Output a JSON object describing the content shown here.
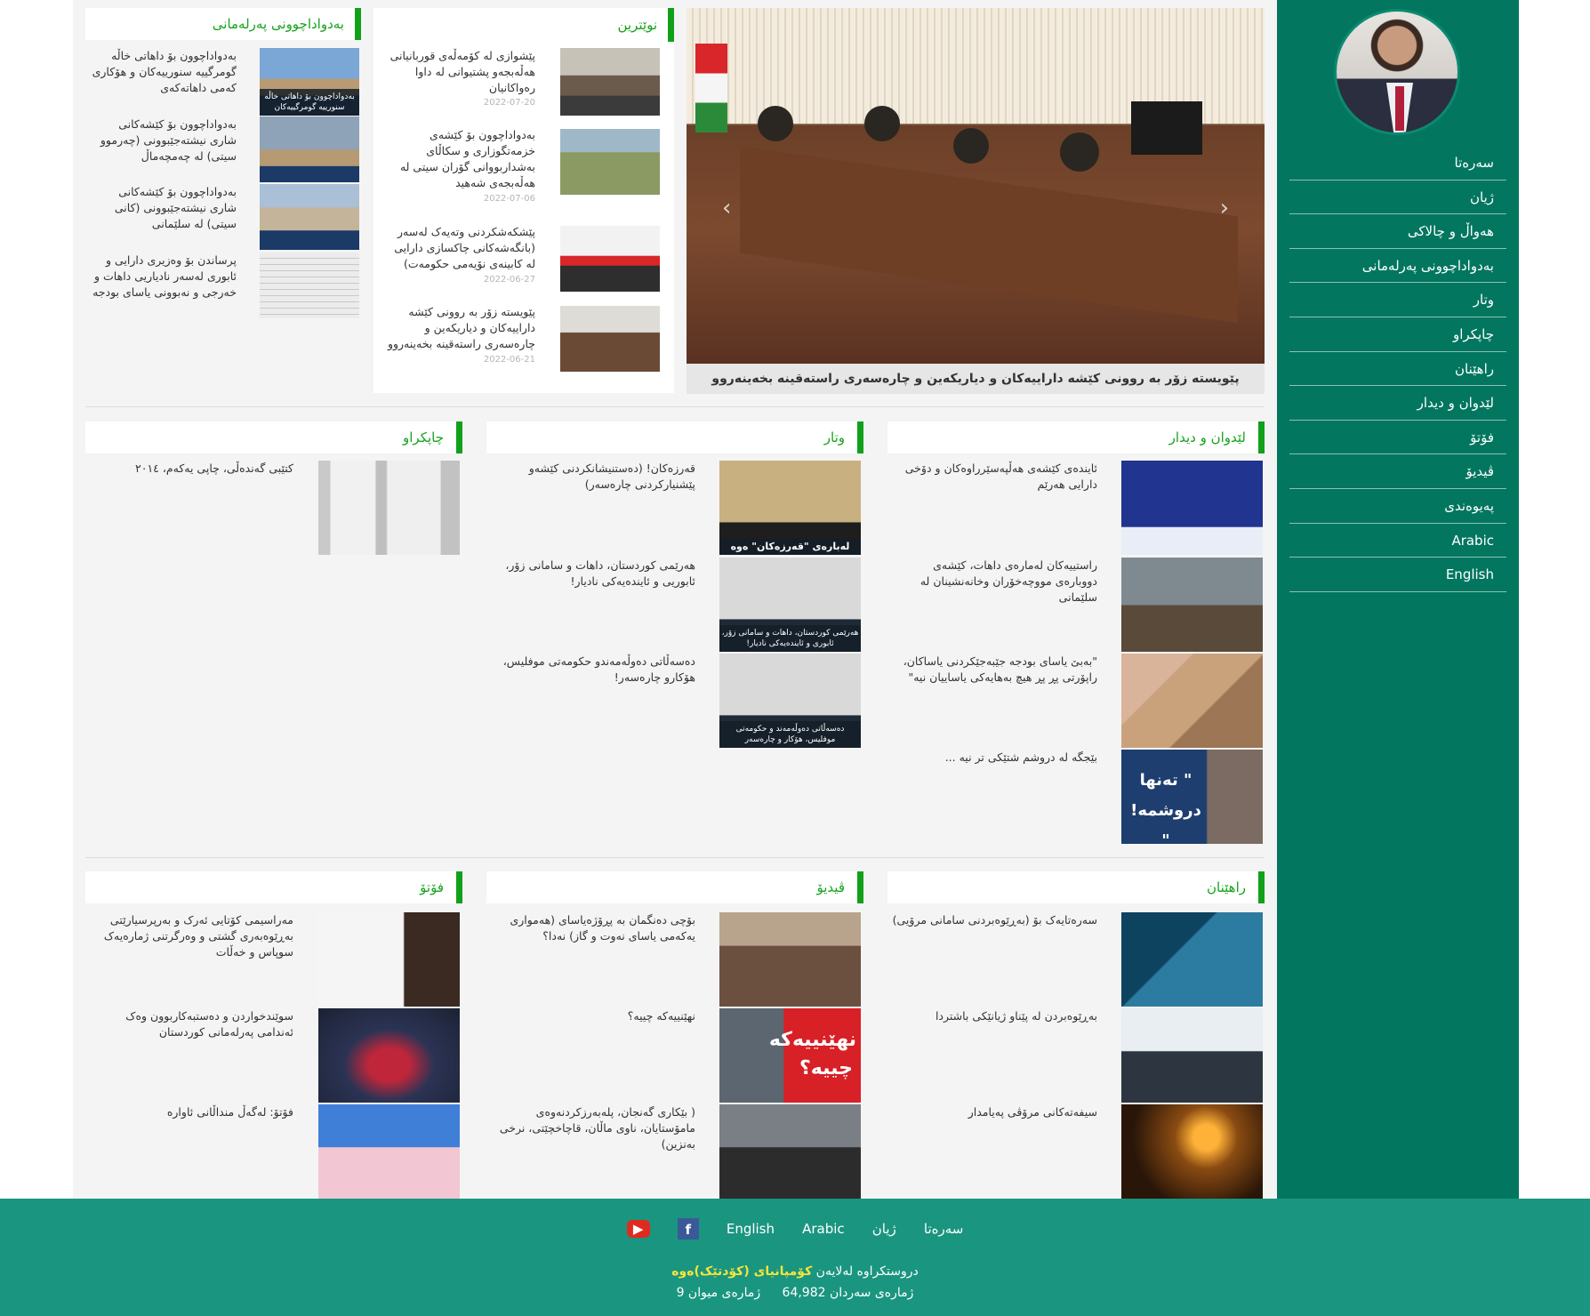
{
  "colors": {
    "sidebar": "#02765f",
    "accent": "#12a01b",
    "footer": "#1a9580",
    "heading_text": "#16a21c"
  },
  "sidebar": {
    "avatar": "profile-photo",
    "nav": [
      "سەرەتا",
      "ژیان",
      "هەواڵ و چالاکی",
      "بەدواداچوونی پەرلەمانی",
      "وتار",
      "چاپکراو",
      "راهێنان",
      "لێدوان و دیدار",
      "فۆتۆ",
      "ڤیدیۆ",
      "پەیوەندی",
      "Arabic",
      "English"
    ]
  },
  "slider": {
    "caption": "پێویستە زۆر بە روونی کێشە داراییەکان و دیاریکەین و چارەسەری راستەقینە بخەینەروو",
    "prev_icon": "chevron-left-icon",
    "next_icon": "chevron-right-icon"
  },
  "latest": {
    "title": "نوێترین",
    "items": [
      {
        "text": "پێشوازی لە کۆمەڵەی قوربانیانی هەڵەبجەو پشتیوانی لە داوا رەواکانیان",
        "date": "2022-07-20"
      },
      {
        "text": "بەدواداچوون بۆ کێشەی خزمەتگوزاری و سکاڵای بەشداربووانی گۆران سیتی لە هەڵەبجەی شەهید",
        "date": "2022-07-06"
      },
      {
        "text": "پێشکەشکردنی وتەیەک لەسەر (بانگەشەکانی چاکسازی دارایی لە کابینەی نۆیەمی حکومەت)",
        "date": "2022-06-27"
      },
      {
        "text": "پێویستە زۆر بە روونی کێشە داراییەکان و دیاریکەین و چارەسەری راستەقینە بخەینەروو",
        "date": "2022-06-21"
      }
    ]
  },
  "parliament": {
    "title": "بەدواداچوونی پەرلەمانی",
    "items": [
      {
        "text": "بەدواداچوون بۆ داهاتی خاڵە گومرگییە سنورییەکان و هۆکاری کەمی داهاتەکەی",
        "caption": "بەدواداچوون بۆ داهاتی خاڵە سنورییە گومرگییەکان"
      },
      {
        "text": "بەدواداچوون بۆ کێشەکانی شاری نیشتەجێبوونی (چەرموو سیتی) لە چەمچەماڵ",
        "caption": ""
      },
      {
        "text": "بەدواداچوون بۆ کێشەکانی شاری نیشتەجێبوونی (کانی سیتی) لە سلێمانی",
        "caption": ""
      },
      {
        "text": "پرساندن بۆ وەزیری دارایی و ئابوری لەسەر نادیاریی داهات و خەرجی و نەبوونی یاسای بودجە",
        "caption": ""
      }
    ]
  },
  "interviews": {
    "title": "لێدوان و دیدار",
    "items": [
      {
        "text": "ئایندەی کێشەی هەڵپەسێرراوەکان و دۆخی دارایی هەرێم"
      },
      {
        "text": "راستییەکان لەمارەی داهات، کێشەی دووبارەی مووچەخۆران وخانەنشینان لە سلێمانی"
      },
      {
        "text": "\"بەبێ یاسای بودجە جێبەجێکردنی یاساکان، راپۆرتی پڕ پڕ هیچ بەهایەکی یاساییان نیە\""
      },
      {
        "text": "بێجگە لە دروشم شتێکی تر نیە ..."
      }
    ],
    "slogan_overlay": "\" تەنها دروشمە! \""
  },
  "articles": {
    "title": "وتار",
    "items": [
      {
        "text": "قەرزەکان! (دەستنیشانکردنی کێشەو پێشنیارکردنی چارەسەر)",
        "caption": "لەبارەی \"قەرزەکان\" ەوە"
      },
      {
        "text": "هەرێمی کوردستان، داهات و سامانی زۆر، ئابوریی و ئایندەیەکی نادیار!",
        "caption": "هەرێمی کوردستان، داهات و سامانی زۆر، ئابوری و ئایندەیەکی نادیار!"
      },
      {
        "text": "دەسەڵاتی دەوڵەمەندو حکومەتی موفلیس، هۆکارو چارەسەر!",
        "caption": "دەسەڵاتی دەوڵەمەند و حکومەتی موفلیس، هۆکار و چارەسەر"
      }
    ]
  },
  "published": {
    "title": "چاپکراو",
    "items": [
      {
        "text": "کتێبی گەندەڵی، چاپی یەکەم، ٢٠١٤"
      }
    ]
  },
  "training": {
    "title": "راهێنان",
    "items": [
      {
        "text": "سەرەتایەک بۆ (بەڕێوەبردنی سامانی مرۆیی)"
      },
      {
        "text": "بەڕێوەبردن لە پێناو ژیانێکی باشتردا"
      },
      {
        "text": "سیفەتەکانی مرۆڤی پەیامدار"
      }
    ]
  },
  "video": {
    "title": "ڤیدیۆ",
    "items": [
      {
        "text": "بۆچی دەنگمان بە پڕۆژەیاسای (هەمواری یەکەمی یاسای نەوت و گاز) نەدا؟"
      },
      {
        "text": "نهێنییەکە چییە؟"
      },
      {
        "text": "( بێکاری گەنجان، پلەبەرزکردنەوەی مامۆستایان، ناوی ماڵان، قاچاخچێتی، نرخی بەنزین)"
      }
    ],
    "overlay": "نهێنییەکە چییە؟"
  },
  "photo": {
    "title": "فۆتۆ",
    "items": [
      {
        "text": "مەراسیمی کۆتایی ئەرک و بەرپرسیارێتی بەڕێوەبەری گشتی و وەرگرتنی ژمارەیەک سوپاس و خەڵات"
      },
      {
        "text": "سوێندخواردن و دەستبەکاربوون وەک ئەندامی پەرلەمانی کوردستان"
      },
      {
        "text": "فۆتۆ: لەگەڵ منداڵانی ئاوارە"
      }
    ]
  },
  "footer": {
    "links": [
      "سەرەتا",
      "ژیان",
      "Arabic",
      "English"
    ],
    "facebook_icon": "facebook-icon",
    "youtube_icon": "youtube-icon",
    "credit_prefix": "دروستکراوە لەلایەن",
    "credit_company": "کۆمپانیای (کۆدتێک)ەوە",
    "visitors": "ژمارەی سەردان 64,982",
    "guests": "ژمارەی میوان 9"
  }
}
